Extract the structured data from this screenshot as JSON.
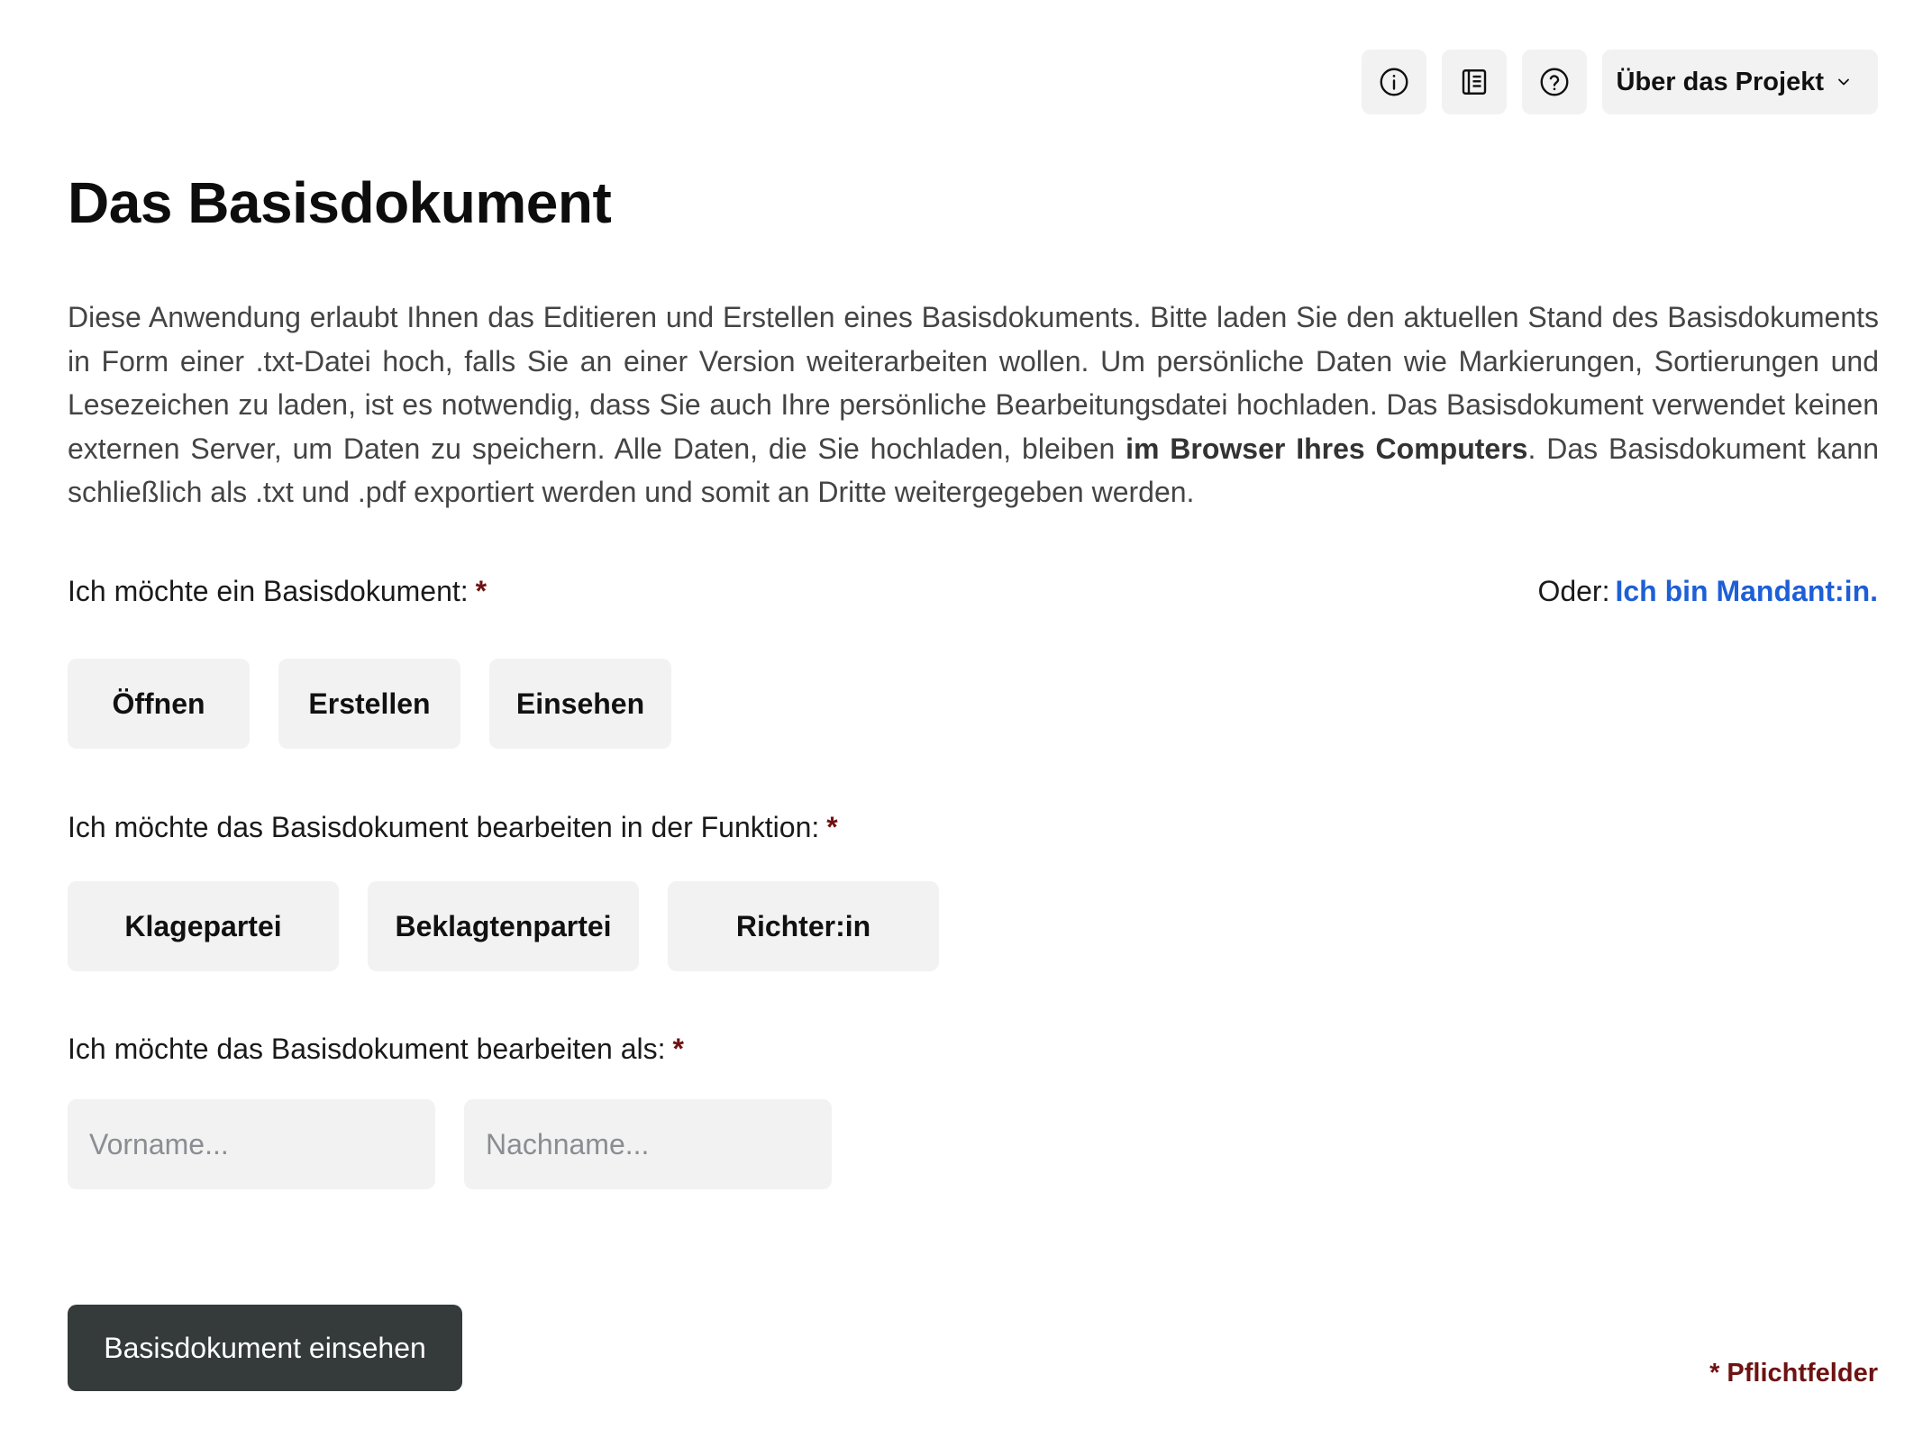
{
  "header": {
    "info_icon": "info-circle-icon",
    "document_icon": "document-list-icon",
    "help_icon": "question-circle-icon",
    "about_menu_label": "Über das Projekt"
  },
  "page": {
    "title": "Das Basisdokument",
    "intro_text": "Diese Anwendung erlaubt Ihnen das Editieren und Erstellen eines Basisdokuments. Bitte laden Sie den aktuellen Stand des Basisdokuments in Form einer .txt-Datei hoch, falls Sie an einer Version weiterarbeiten wollen. Um persönliche Daten wie Markierungen, Sortierungen und Lesezeichen zu laden, ist es notwendig, dass Sie auch Ihre persönliche Bearbeitungsdatei hochladen. Das Basisdokument verwendet keinen externen Server, um Daten zu speichern. Alle Daten, die Sie hochladen, bleiben ",
    "intro_bold": "im Browser Ihres Computers",
    "intro_text_end": ". Das Basisdokument kann schließlich als .txt und .pdf exportiert werden und somit an Dritte weitergegeben werden."
  },
  "mode": {
    "label": "Ich möchte ein Basisdokument:",
    "required_marker": "*",
    "options": [
      "Öffnen",
      "Erstellen",
      "Einsehen"
    ]
  },
  "client": {
    "prefix": "Oder:",
    "link_label": "Ich bin Mandant:in."
  },
  "role": {
    "label": "Ich möchte das Basisdokument bearbeiten in der Funktion:",
    "required_marker": "*",
    "options": [
      "Klagepartei",
      "Beklagtenpartei",
      "Richter:in"
    ]
  },
  "identity": {
    "label": "Ich möchte das Basisdokument bearbeiten als:",
    "required_marker": "*",
    "first_name_placeholder": "Vorname...",
    "last_name_placeholder": "Nachname...",
    "first_name_value": "",
    "last_name_value": ""
  },
  "footer": {
    "submit_label": "Basisdokument einsehen",
    "required_note": "* Pflichtfelder"
  },
  "colors": {
    "required": "#6e1212",
    "link": "#1e5fd6",
    "primary_button": "#353a3a",
    "choice_button": "#f2f2f2"
  }
}
